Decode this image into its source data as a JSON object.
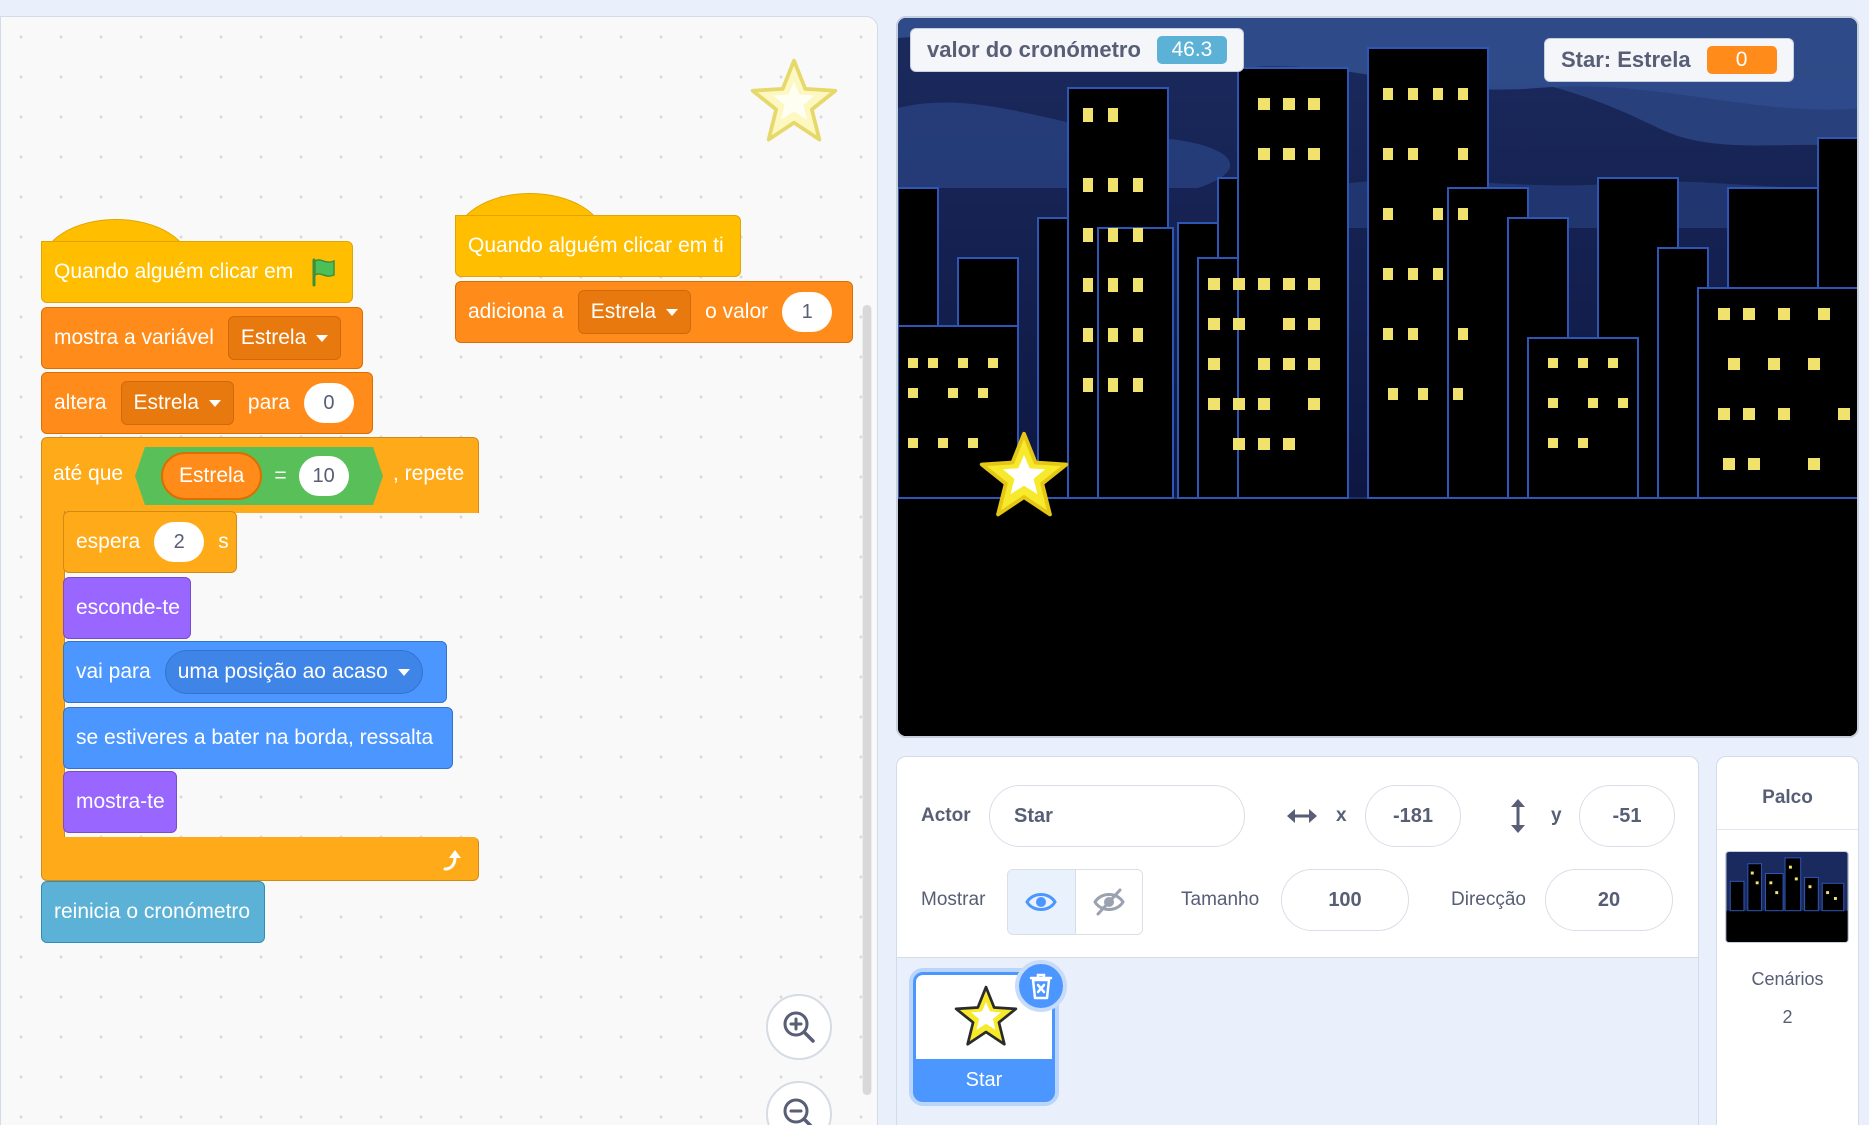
{
  "code": {
    "script1": {
      "hat_label": "Quando alguém clicar em",
      "show_var_label": "mostra a variável",
      "show_var_name": "Estrela",
      "set_label": "altera",
      "set_var_name": "Estrela",
      "set_to_label": "para",
      "set_value": "0",
      "repeat_until_label": "até que",
      "cond_var": "Estrela",
      "cond_op": "=",
      "cond_value": "10",
      "repeat_label": ", repete",
      "wait_label": "espera",
      "wait_value": "2",
      "wait_unit": "s",
      "hide_label": "esconde-te",
      "goto_label": "vai para",
      "goto_target": "uma posição ao acaso",
      "bounce_label": "se estiveres a bater na borda, ressalta",
      "show_label": "mostra-te",
      "reset_timer_label": "reinicia o cronómetro"
    },
    "script2": {
      "hat_label": "Quando alguém clicar em ti",
      "change_label": "adiciona a",
      "change_var": "Estrela",
      "change_by_label": "o valor",
      "change_value": "1"
    }
  },
  "stage": {
    "timer_monitor": {
      "label": "valor do cronómetro",
      "value": "46.3",
      "color": "#5cb1d6"
    },
    "var_monitor": {
      "label": "Star: Estrela",
      "value": "0",
      "color": "#ff8c1a"
    }
  },
  "sprite_info": {
    "actor_label": "Actor",
    "actor_name": "Star",
    "x_label": "x",
    "x_value": "-181",
    "y_label": "y",
    "y_value": "-51",
    "show_label": "Mostrar",
    "size_label": "Tamanho",
    "size_value": "100",
    "direction_label": "Direcção",
    "direction_value": "20",
    "sprites": [
      {
        "name": "Star",
        "selected": true
      }
    ]
  },
  "stage_panel": {
    "title": "Palco",
    "backdrops_label": "Cenários",
    "backdrops_count": "2"
  },
  "icons": [
    "green-flag-icon",
    "star-icon",
    "zoom-in-icon",
    "zoom-out-icon",
    "eye-icon",
    "eye-off-icon",
    "trash-icon",
    "loop-arrow-icon",
    "horizontal-arrows-icon",
    "vertical-arrows-icon"
  ],
  "colors": {
    "events": "#ffbf00",
    "variables": "#ff8c1a",
    "control": "#ffab19",
    "looks": "#9966ff",
    "motion": "#4c97ff",
    "sensing": "#5cb1d6",
    "operators": "#59c059",
    "accent": "#4c97ff"
  }
}
